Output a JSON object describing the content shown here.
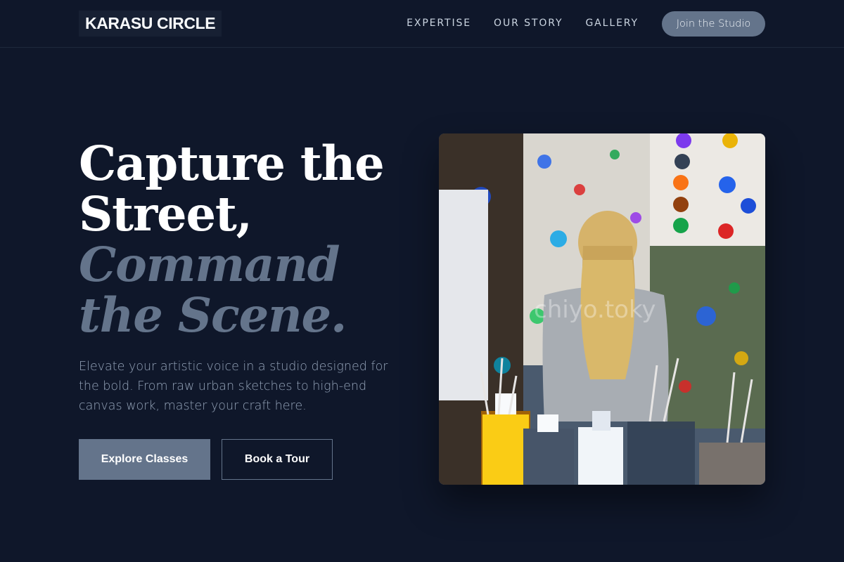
{
  "header": {
    "logo": "KARASU CIRCLE",
    "nav": [
      {
        "label": "EXPERTISE"
      },
      {
        "label": "OUR STORY"
      },
      {
        "label": "GALLERY"
      }
    ],
    "cta_label": "Join the Studio"
  },
  "hero": {
    "title_line1": "Capture the Street,",
    "title_line2": "Command the Scene.",
    "description": "Elevate your artistic voice in a studio designed for the bold. From raw urban sketches to high-end canvas work, master your craft here.",
    "primary_button": "Explore Classes",
    "secondary_button": "Book a Tour"
  },
  "image": {
    "subject": "child-painting-studio",
    "watermark": "chiyo.toky"
  },
  "colors": {
    "background": "#0f172a",
    "accent": "#64748b",
    "text": "#ffffff",
    "muted": "#94a3b8"
  }
}
